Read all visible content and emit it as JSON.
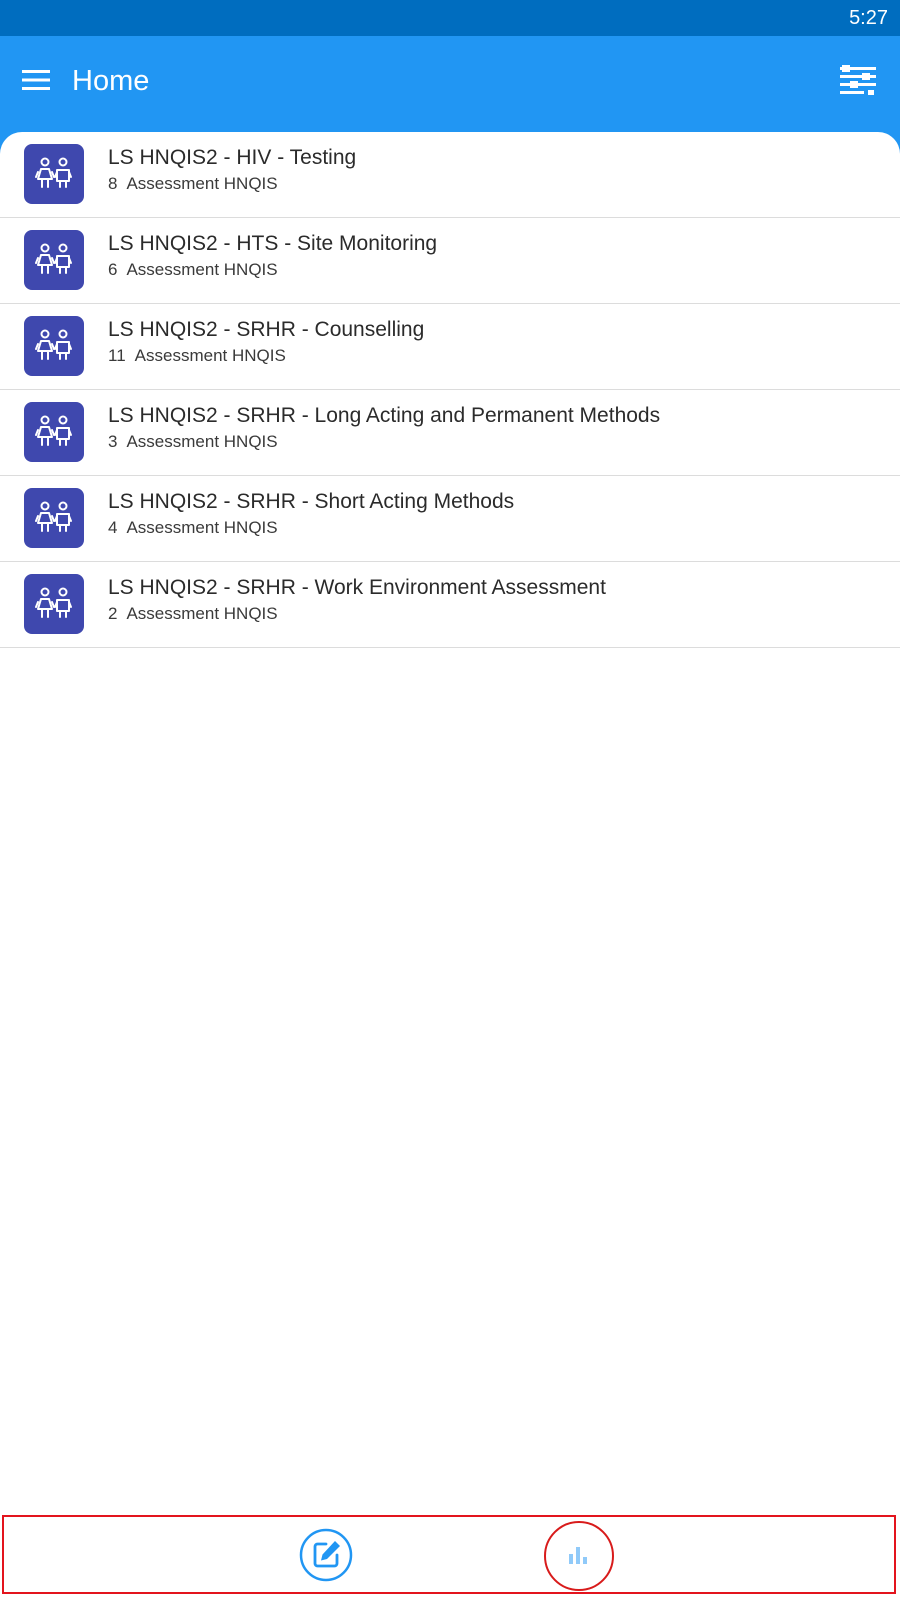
{
  "status_bar": {
    "time": "5:27"
  },
  "app_bar": {
    "title": "Home",
    "menu_icon": "hamburger-menu-icon",
    "filter_icon": "filter-sliders-icon"
  },
  "programs": [
    {
      "title": "LS HNQIS2 - HIV - Testing",
      "count": "8",
      "subtitle": "Assessment HNQIS"
    },
    {
      "title": "LS HNQIS2 - HTS - Site Monitoring",
      "count": "6",
      "subtitle": "Assessment HNQIS"
    },
    {
      "title": "LS HNQIS2 - SRHR - Counselling",
      "count": "11",
      "subtitle": "Assessment HNQIS"
    },
    {
      "title": "LS HNQIS2 - SRHR - Long Acting and Permanent Methods",
      "count": "3",
      "subtitle": "Assessment HNQIS"
    },
    {
      "title": "LS HNQIS2 - SRHR - Short Acting Methods",
      "count": "4",
      "subtitle": "Assessment HNQIS"
    },
    {
      "title": "LS HNQIS2 - SRHR - Work Environment Assessment",
      "count": "2",
      "subtitle": "Assessment HNQIS"
    }
  ],
  "bottom_nav": {
    "items": [
      {
        "icon": "edit-square-icon"
      },
      {
        "icon": "bar-chart-icon"
      }
    ]
  },
  "colors": {
    "status_bar": "#006dbf",
    "app_bar": "#2196f3",
    "program_icon_bg": "#3f48ae",
    "highlight": "#e3141d"
  }
}
